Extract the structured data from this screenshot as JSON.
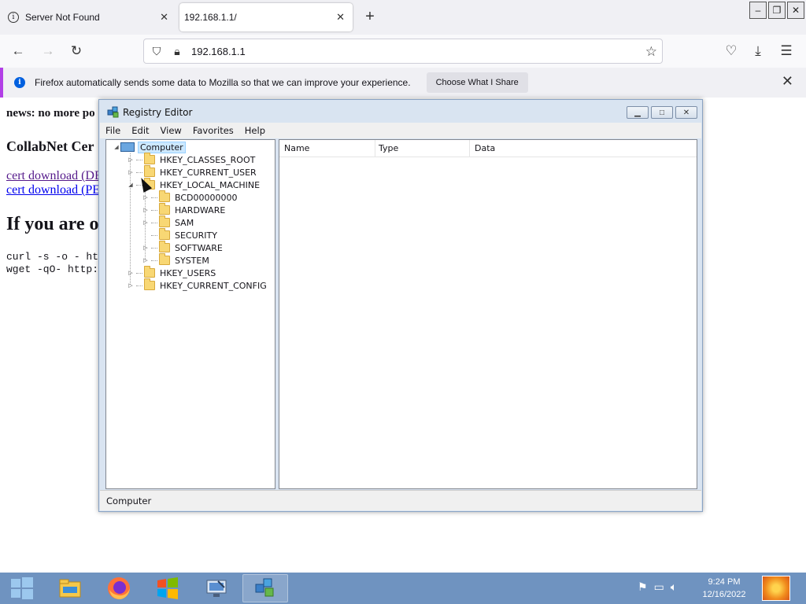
{
  "browser": {
    "tabs": [
      {
        "label": "Server Not Found"
      },
      {
        "label": "192.168.1.1/"
      }
    ],
    "url": "192.168.1.1",
    "notification": {
      "text": "Firefox automatically sends some data to Mozilla so that we can improve your experience.",
      "button": "Choose What I Share"
    }
  },
  "page": {
    "news": "news: no more po",
    "collab_heading": "CollabNet Cer",
    "cert_der": "cert download (DE",
    "cert_pem": "cert download (PE",
    "if_heading": "If you are o",
    "curl_line": "curl -s -o - http",
    "wget_line": "wget -qO- http://"
  },
  "registry": {
    "title": "Registry Editor",
    "menu": [
      "File",
      "Edit",
      "View",
      "Favorites",
      "Help"
    ],
    "tree": {
      "root": "Computer",
      "hives": [
        "HKEY_CLASSES_ROOT",
        "HKEY_CURRENT_USER",
        "HKEY_LOCAL_MACHINE",
        "HKEY_USERS",
        "HKEY_CURRENT_CONFIG"
      ],
      "hklm_children": [
        "BCD00000000",
        "HARDWARE",
        "SAM",
        "SECURITY",
        "SOFTWARE",
        "SYSTEM"
      ]
    },
    "columns": [
      "Name",
      "Type",
      "Data"
    ],
    "status": "Computer"
  },
  "taskbar": {
    "time": "9:24 PM",
    "date": "12/16/2022"
  },
  "colors": {
    "taskbar": "#6f93c0",
    "selection": "#cce8ff",
    "notice_accent": "#b23fe6"
  }
}
